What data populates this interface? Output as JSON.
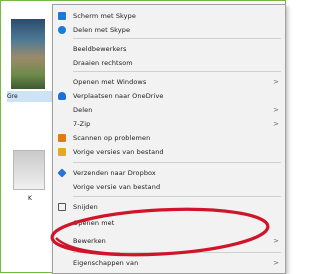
{
  "desktop": {
    "file1_label": "Gre",
    "file2_label": "K"
  },
  "menu": {
    "items": [
      {
        "label": "Scherm met Skype",
        "icon_color": "#1d7ad6",
        "arrow": ""
      },
      {
        "label": "Delen met Skype",
        "icon_color": "#1d7ad6",
        "arrow": ""
      },
      {
        "label": "Beeldbewerkers",
        "icon_color": "",
        "arrow": ""
      },
      {
        "label": "Draaien rechtsom",
        "icon_color": "",
        "arrow": ""
      },
      {
        "label": "Openen met Windows",
        "icon_color": "",
        "arrow": ">"
      },
      {
        "label": "Verplaatsen naar OneDrive",
        "icon_color": "#1d6fd8",
        "arrow": ""
      },
      {
        "label": "Delen",
        "icon_color": "",
        "arrow": ">"
      },
      {
        "label": "7-Zip",
        "icon_color": "",
        "arrow": ">"
      },
      {
        "label": "Scannen op problemen",
        "icon_color": "#e07b1a",
        "arrow": ""
      },
      {
        "label": "Vorige versies van bestand",
        "icon_color": "#e5a823",
        "arrow": ""
      },
      {
        "label": "Verzenden naar Dropbox",
        "icon_color": "#2b73d4",
        "arrow": ""
      },
      {
        "label": "Vorige versie van bestand",
        "icon_color": "",
        "arrow": ""
      },
      {
        "label": "Snijden",
        "icon_color": "",
        "arrow": ""
      },
      {
        "label": "Openen met",
        "icon_color": "",
        "arrow": ""
      },
      {
        "label": "Bewerken",
        "icon_color": "",
        "arrow": ">"
      },
      {
        "label": "Eigenschappen van",
        "icon_color": "",
        "arrow": ">"
      }
    ]
  },
  "annotation": {
    "color": "#d0152a"
  }
}
